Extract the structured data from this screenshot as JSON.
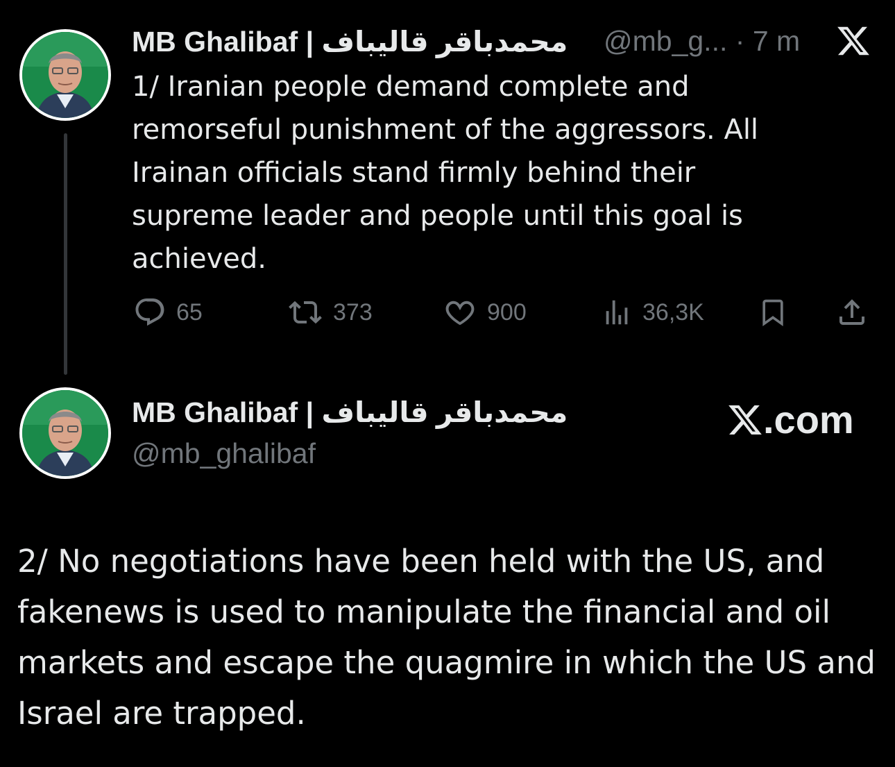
{
  "tweet1": {
    "display_name": "MB Ghalibaf | محمدباقر قالیباف",
    "handle_truncated": "@mb_g...",
    "separator": "·",
    "time_ago": "7 m",
    "text": "1/ Iranian people demand complete and remorseful punishment of the aggressors. All Irainan officials stand firmly behind their supreme leader and people until this goal is achieved.",
    "actions": {
      "replies": "65",
      "reposts": "373",
      "likes": "900",
      "views": "36,3K"
    }
  },
  "tweet2": {
    "display_name": "MB Ghalibaf | محمدباقر قالیباف",
    "handle": "@mb_ghalibaf",
    "source_label": ".com",
    "text": "2/ No negotiations have been held with the US, and fakenews is used to manipulate the financial and oil markets and escape the quagmire in which the US and Israel are trapped."
  },
  "colors": {
    "background": "#000000",
    "text": "#e7e9ea",
    "muted": "#71767b",
    "thread_line": "#333639",
    "avatar_bg": "#1a8a4a"
  },
  "icons": {
    "close": "x-logo-icon",
    "reply": "reply-icon",
    "repost": "repost-icon",
    "like": "heart-icon",
    "views": "views-icon",
    "bookmark": "bookmark-icon",
    "share": "share-icon"
  }
}
